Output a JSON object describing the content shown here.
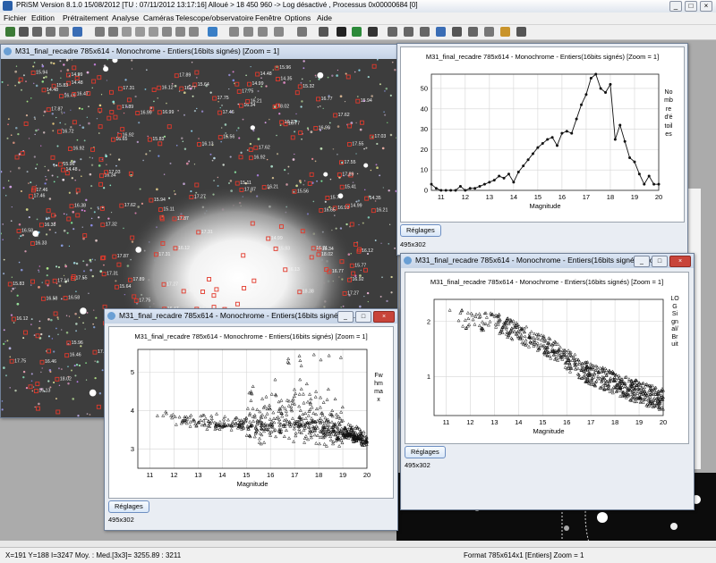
{
  "app": {
    "title": "PRiSM     Version 8.1.0    15/08/2012    [TU : 07/11/2012 13:17:16]  Alloué > 18 450 960 -> Log désactivé , Processus 0x00000684 [0]"
  },
  "menu": [
    "Fichier",
    "Edition",
    "Prétraitement",
    "Analyse",
    "Caméras",
    "Telescope/observatoire",
    "Fenêtre",
    "Options",
    "Aide"
  ],
  "image_window": {
    "title": "M31_final_recadre 785x614 - Monochrome - Entiers(16bits signés)  [Zoom = 1]",
    "star_labels": [
      "15.32",
      "16.58",
      "17.32",
      "16.46",
      "15.94",
      "17.55",
      "16.34",
      "15.83",
      "17.87",
      "16.21",
      "15.64",
      "14.99",
      "16.72",
      "17.46",
      "15.11",
      "16.99",
      "17.75",
      "14.48",
      "16.13",
      "15.77",
      "18.02",
      "17.27",
      "16.65",
      "15.41",
      "17.62",
      "16.92",
      "15.08",
      "16.38",
      "17.14",
      "18.38",
      "16.33",
      "15.56",
      "17.89",
      "16.77",
      "14.35",
      "17.03",
      "15.96",
      "16.12",
      "17.31",
      "16.47"
    ]
  },
  "windows": {
    "hist": {
      "plot_title": "M31_final_recadre 785x614 - Monochrome - Entiers(16bits signés)    [Zoom = 1]",
      "button": "Réglages",
      "size": "495x302"
    },
    "snr": {
      "title": "M31_final_recadre 785x614 - Monochrome - Entiers(16bits signés)  [Zo...",
      "plot_title": "M31_final_recadre 785x614 - Monochrome - Entiers(16bits signés)    [Zoom = 1]",
      "button": "Réglages",
      "size": "495x302"
    },
    "fwhm": {
      "title": "M31_final_recadre 785x614 - Monochrome - Entiers(16bits signés)  [Z...",
      "plot_title": "M31_final_recadre 785x614 - Monochrome - Entiers(16bits signés)    [Zoom = 1]",
      "button": "Réglages",
      "size": "495x302"
    }
  },
  "status": {
    "left": "X=191  Y=188  I=3247   Moy. : Med.[3x3]= 3255.89 : 3211",
    "right": "Format 785x614x1 [Entiers]  Zoom = 1"
  },
  "chart_data": [
    {
      "type": "line",
      "xlabel": "Magnitude",
      "ylabel": "Nombre d'étoiles",
      "xlim": [
        10.6,
        20
      ],
      "ylim": [
        0,
        57
      ],
      "x_ticks": [
        11,
        12,
        13,
        14,
        15,
        16,
        17,
        18,
        19,
        20
      ],
      "y_ticks": [
        0,
        10,
        20,
        30,
        40,
        50
      ],
      "x": [
        10.6,
        10.8,
        11.0,
        11.2,
        11.4,
        11.6,
        11.8,
        12.0,
        12.2,
        12.4,
        12.6,
        12.8,
        13.0,
        13.2,
        13.4,
        13.6,
        13.8,
        14.0,
        14.2,
        14.4,
        14.6,
        14.8,
        15.0,
        15.2,
        15.4,
        15.6,
        15.8,
        16.0,
        16.2,
        16.4,
        16.6,
        16.8,
        17.0,
        17.2,
        17.4,
        17.6,
        17.8,
        18.0,
        18.2,
        18.4,
        18.6,
        18.8,
        19.0,
        19.2,
        19.4,
        19.6,
        19.8,
        20.0
      ],
      "y": [
        3,
        1,
        0,
        0,
        0,
        0,
        2,
        0,
        1,
        1,
        2,
        3,
        4,
        5,
        7,
        6,
        8,
        4,
        9,
        12,
        15,
        18,
        21,
        23,
        25,
        26,
        22,
        28,
        29,
        28,
        35,
        42,
        47,
        55,
        57,
        50,
        48,
        52,
        25,
        32,
        24,
        16,
        14,
        8,
        3,
        7,
        3,
        3
      ],
      "grid": true
    },
    {
      "type": "scatter",
      "xlabel": "Magnitude",
      "ylabel": "LOG Signal/Bruit",
      "xlim": [
        10.5,
        20
      ],
      "ylim": [
        0.3,
        2.4
      ],
      "x_ticks": [
        11,
        12,
        13,
        14,
        15,
        16,
        17,
        18,
        19,
        20
      ],
      "y_ticks": [
        1,
        2
      ],
      "trend": {
        "x": [
          11.0,
          13.0,
          15.0,
          17.0,
          19.0,
          20.0
        ],
        "y": [
          2.05,
          2.0,
          1.6,
          1.05,
          0.72,
          0.58
        ]
      },
      "grid": true
    },
    {
      "type": "scatter",
      "xlabel": "Magnitude",
      "ylabel": "Fwhm max",
      "xlim": [
        10.5,
        20
      ],
      "ylim": [
        2.5,
        5.6
      ],
      "x_ticks": [
        11,
        12,
        13,
        14,
        15,
        16,
        17,
        18,
        19,
        20
      ],
      "y_ticks": [
        3,
        4,
        5
      ],
      "trend": {
        "x": [
          11.0,
          13.0,
          15.0,
          17.0,
          19.0,
          20.0
        ],
        "y": [
          3.9,
          3.65,
          3.6,
          3.65,
          3.4,
          3.2
        ]
      },
      "grid": true
    }
  ]
}
